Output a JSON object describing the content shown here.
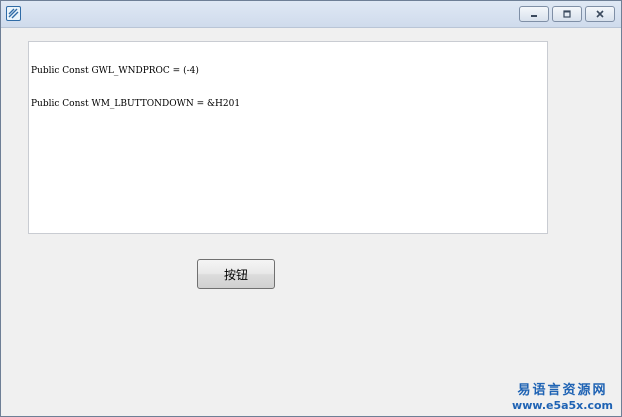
{
  "window": {
    "app_icon": "app-icon",
    "controls": {
      "minimize_icon": "minimize-icon",
      "maximize_icon": "maximize-icon",
      "close_icon": "close-icon"
    }
  },
  "editbox": {
    "lines": [
      "Public Const GWL_WNDPROC = (-4)",
      "Public Const WM_LBUTTONDOWN = &H201"
    ]
  },
  "button": {
    "label": "按钮"
  },
  "watermark": {
    "line1": "易语言资源网",
    "line2": "www.e5a5x.com"
  },
  "colors": {
    "window_bg": "#f0f0f0",
    "titlebar": "#d6e1ef",
    "watermark": "#1f63b4"
  }
}
